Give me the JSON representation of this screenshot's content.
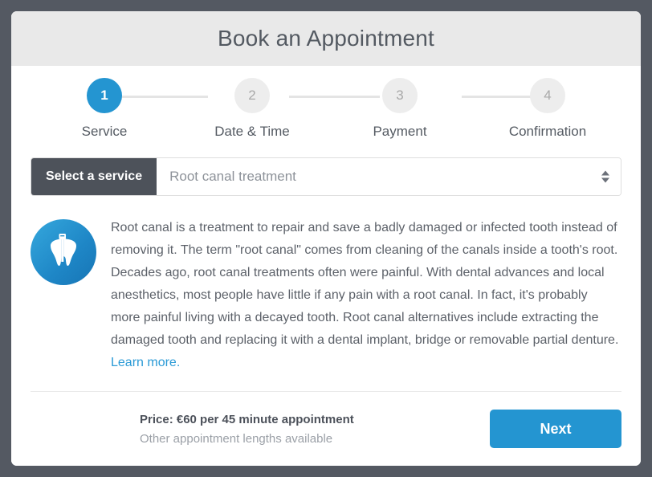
{
  "header": {
    "title": "Book an Appointment"
  },
  "stepper": {
    "steps": [
      {
        "number": "1",
        "label": "Service",
        "state": "active"
      },
      {
        "number": "2",
        "label": "Date & Time",
        "state": "inactive"
      },
      {
        "number": "3",
        "label": "Payment",
        "state": "inactive"
      },
      {
        "number": "4",
        "label": "Confirmation",
        "state": "inactive"
      }
    ]
  },
  "service_select": {
    "prefix_label": "Select a service",
    "selected_value": "Root canal treatment",
    "spinner_up_icon": "caret-up-icon",
    "spinner_down_icon": "caret-down-icon"
  },
  "service_detail": {
    "icon_name": "tooth-root-canal-icon",
    "description": "Root canal is a treatment to repair and save a badly damaged or infected tooth instead of removing it. The term \"root canal\" comes from cleaning of the canals inside a tooth's root. Decades ago, root canal treatments often were painful. With dental advances and local anesthetics, most people have little if any pain with a root canal. In fact, it's probably more painful living with a decayed tooth. Root canal alternatives include extracting the damaged tooth and replacing it with a dental implant, bridge or removable partial denture. ",
    "learn_more_label": "Learn more."
  },
  "footer": {
    "price_text": "Price: €60 per 45 minute appointment",
    "price_note": "Other appointment lengths available",
    "next_label": "Next"
  },
  "colors": {
    "accent_blue": "#2495d1",
    "dark_slate": "#4d525a",
    "page_background": "#545962",
    "header_background": "#e9e9e9",
    "link_blue": "#2a9ad6"
  }
}
